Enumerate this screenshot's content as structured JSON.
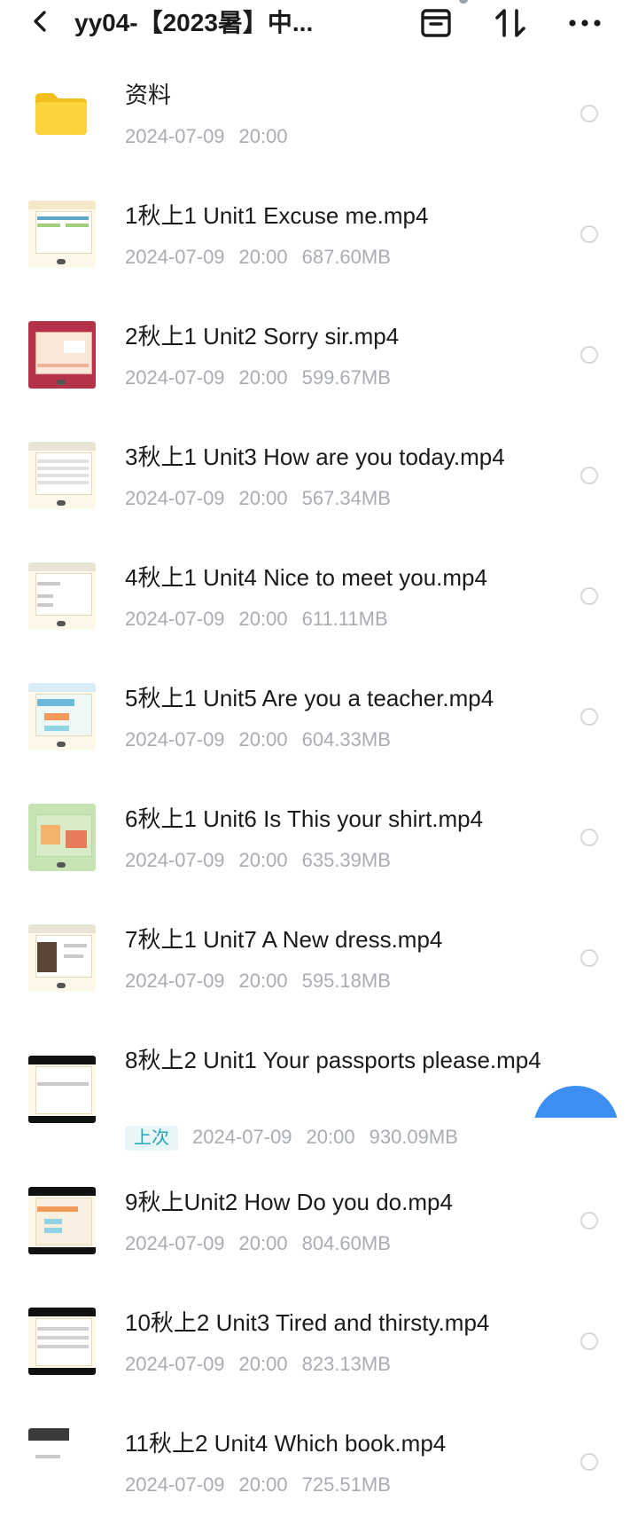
{
  "header": {
    "title": "yy04-【2023暑】中...",
    "icons": [
      "chevron-left-icon",
      "archive-box-icon",
      "sort-icon",
      "more-icon"
    ]
  },
  "colors": {
    "text": "#1a1a1a",
    "meta": "#a9adb3",
    "tag_bg": "#e8f6f8",
    "tag_text": "#25a6b8",
    "fab": "#3c8ff0",
    "folder": "#f7c933"
  },
  "files": [
    {
      "name": "资料",
      "date": "2024-07-09",
      "time": "20:00",
      "size": "",
      "type": "folder"
    },
    {
      "name": "1秋上1 Unit1 Excuse me.mp4",
      "date": "2024-07-09",
      "time": "20:00",
      "size": "687.60MB",
      "type": "video"
    },
    {
      "name": "2秋上1 Unit2 Sorry sir.mp4",
      "date": "2024-07-09",
      "time": "20:00",
      "size": "599.67MB",
      "type": "video"
    },
    {
      "name": "3秋上1 Unit3 How are you today.mp4",
      "date": "2024-07-09",
      "time": "20:00",
      "size": "567.34MB",
      "type": "video"
    },
    {
      "name": "4秋上1 Unit4 Nice to meet you.mp4",
      "date": "2024-07-09",
      "time": "20:00",
      "size": "611.11MB",
      "type": "video"
    },
    {
      "name": "5秋上1 Unit5 Are you a teacher.mp4",
      "date": "2024-07-09",
      "time": "20:00",
      "size": "604.33MB",
      "type": "video"
    },
    {
      "name": "6秋上1 Unit6 Is This your shirt.mp4",
      "date": "2024-07-09",
      "time": "20:00",
      "size": "635.39MB",
      "type": "video"
    },
    {
      "name": "7秋上1 Unit7 A New dress.mp4",
      "date": "2024-07-09",
      "time": "20:00",
      "size": "595.18MB",
      "type": "video"
    },
    {
      "name": "8秋上2 Unit1 Your passports please.mp4",
      "date": "2024-07-09",
      "time": "20:00",
      "size": "930.09MB",
      "type": "video",
      "tag": "上次"
    },
    {
      "name": "9秋上Unit2 How Do you do.mp4",
      "date": "2024-07-09",
      "time": "20:00",
      "size": "804.60MB",
      "type": "video"
    },
    {
      "name": "10秋上2 Unit3 Tired and thirsty.mp4",
      "date": "2024-07-09",
      "time": "20:00",
      "size": "823.13MB",
      "type": "video"
    },
    {
      "name": "11秋上2 Unit4 Which book.mp4",
      "date": "2024-07-09",
      "time": "20:00",
      "size": "725.51MB",
      "type": "video"
    }
  ]
}
